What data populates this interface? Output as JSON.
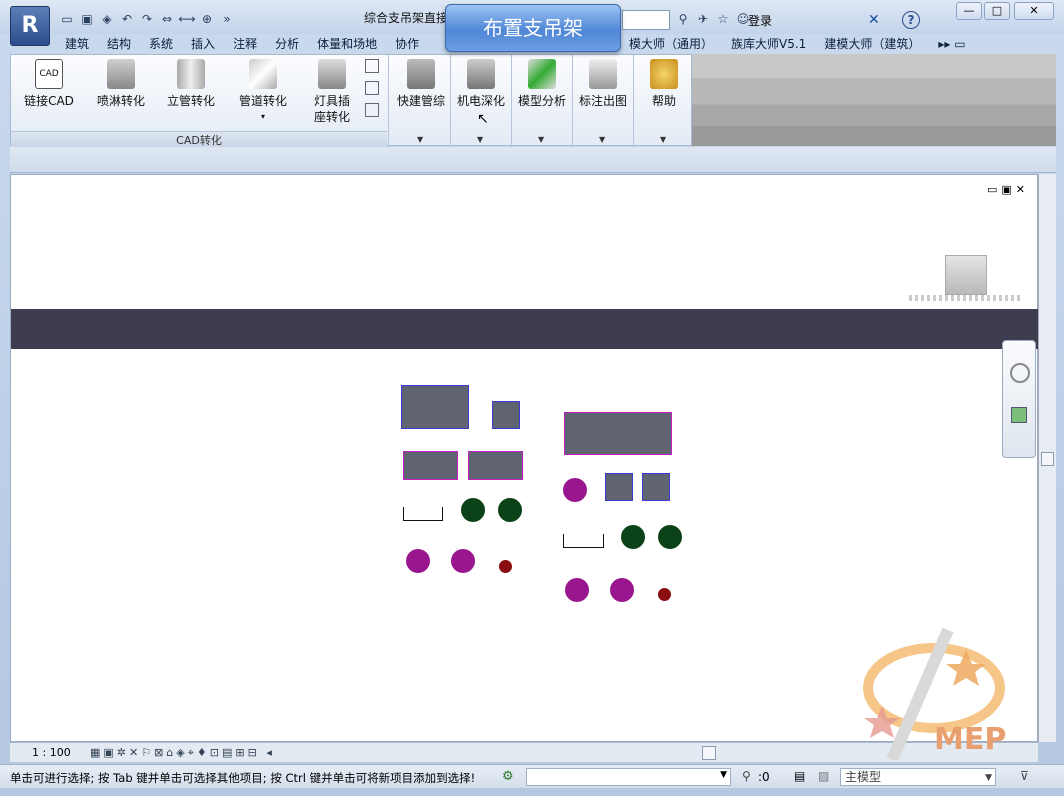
{
  "window": {
    "app_button": "R",
    "doc_title": "综合支吊架直接",
    "login_label": "登录",
    "help_label": "?",
    "min_label": "—",
    "max_label": "□",
    "close_label": "✕"
  },
  "popup": {
    "text": "布置支吊架"
  },
  "tabs": [
    "建筑",
    "结构",
    "系统",
    "插入",
    "注释",
    "分析",
    "体量和场地",
    "协作"
  ],
  "tabs_right": [
    "模大师（通用）",
    "族库大师V5.1",
    "建模大师（建筑）"
  ],
  "ribbon": {
    "buttons": [
      {
        "id": "link-cad",
        "label": "链接CAD",
        "icon": "cad-file-icon"
      },
      {
        "id": "sprinkler",
        "label": "喷淋转化",
        "icon": "sprinkler-icon"
      },
      {
        "id": "riser",
        "label": "立管转化",
        "icon": "riser-pipe-icon"
      },
      {
        "id": "pipe",
        "label": "管道转化",
        "icon": "pipe-icon"
      },
      {
        "id": "lamp",
        "label": "灯具插",
        "label2": "座转化",
        "icon": "lamp-icon"
      },
      {
        "id": "quick-pipe",
        "label": "快建管综",
        "icon": "quick-pipe-icon"
      },
      {
        "id": "mep-detail",
        "label": "机电深化",
        "icon": "mep-detail-icon"
      },
      {
        "id": "model-analysis",
        "label": "模型分析",
        "icon": "model-analysis-icon"
      },
      {
        "id": "annotate",
        "label": "标注出图",
        "icon": "annotate-icon"
      },
      {
        "id": "help",
        "label": "帮助",
        "icon": "help-key-icon"
      }
    ],
    "panel_label": "CAD转化"
  },
  "viewbar": {
    "scale": "1 : 100"
  },
  "status": {
    "text": "单击可进行选择; 按 Tab 键并单击可选择其他项目; 按 Ctrl 键并单击可将新项目添加到选择!",
    "counter": ":0",
    "model": "主模型"
  },
  "logo_text": "MEP",
  "colors": {
    "rect_fill": "#606470",
    "green": "#0c4218",
    "purple": "#9a168e",
    "red": "#8a0d10",
    "banner": "#3d3d4f"
  }
}
